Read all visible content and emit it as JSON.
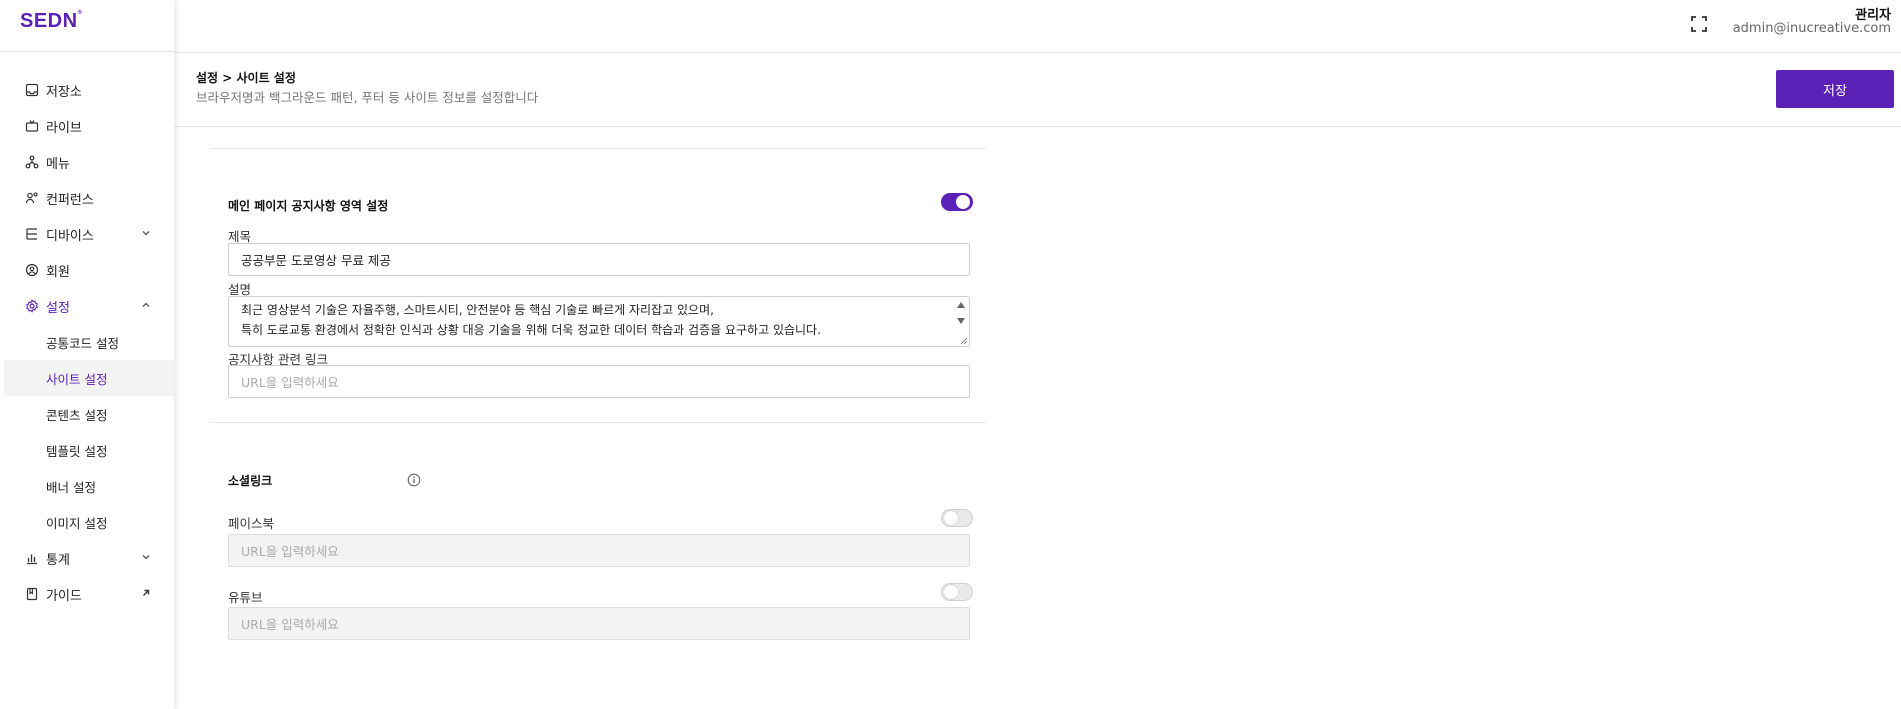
{
  "brand": {
    "logo": "SEDN",
    "accent": "#5b21b6"
  },
  "sidebar": {
    "items": [
      {
        "label": "저장소",
        "icon": "storage-icon"
      },
      {
        "label": "라이브",
        "icon": "tv-icon"
      },
      {
        "label": "메뉴",
        "icon": "menu-tree-icon"
      },
      {
        "label": "컨퍼런스",
        "icon": "people-icon"
      },
      {
        "label": "디바이스",
        "icon": "device-icon",
        "expandable": true
      },
      {
        "label": "회원",
        "icon": "user-icon"
      },
      {
        "label": "설정",
        "icon": "gear-icon",
        "expanded": true
      },
      {
        "label": "통계",
        "icon": "chart-icon",
        "expandable": true
      },
      {
        "label": "가이드",
        "icon": "book-icon",
        "external": true
      }
    ],
    "settings_sub": [
      {
        "label": "공통코드 설정"
      },
      {
        "label": "사이트 설정",
        "active": true
      },
      {
        "label": "콘텐츠 설정"
      },
      {
        "label": "템플릿 설정"
      },
      {
        "label": "배너 설정"
      },
      {
        "label": "이미지 설정"
      }
    ]
  },
  "header": {
    "user_name": "관리자",
    "user_email": "admin@inucreative.com"
  },
  "subheader": {
    "breadcrumb": "설정 > 사이트 설정",
    "description": "브라우저명과 백그라운드 패턴, 푸터 등 사이트 정보를 설정합니다",
    "save_label": "저장"
  },
  "notice": {
    "section_title": "메인 페이지 공지사항 영역 설정",
    "enabled": true,
    "title_label": "제목",
    "title_value": "공공부문 도로영상 무료 제공",
    "desc_label": "설명",
    "desc_lines": [
      "최근 영상분석 기술은 자율주행, 스마트시티, 안전분야 등 핵심 기술로 빠르게 자리잡고 있으며,",
      "특히 도로교통 환경에서 정확한 인식과 상황 대응 기술을 위해 더욱 정교한 데이터 학습과 검증을 요구하고 있습니다."
    ],
    "link_label": "공지사항 관련 링크",
    "link_placeholder": "URL을 입력하세요"
  },
  "social": {
    "section_title": "소셜링크",
    "items": [
      {
        "label": "페이스북",
        "enabled": false,
        "placeholder": "URL을 입력하세요"
      },
      {
        "label": "유튜브",
        "enabled": false,
        "placeholder": "URL을 입력하세요"
      }
    ]
  }
}
